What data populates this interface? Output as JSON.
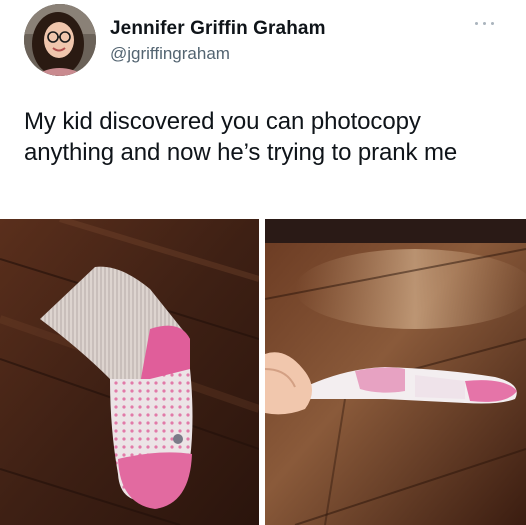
{
  "tweet": {
    "author": {
      "display_name": "Jennifer Griffin Graham",
      "handle": "@jgriffingraham",
      "avatar_icon": "profile-photo"
    },
    "more_icon": "more-options-icon",
    "text": "My kid discovered you can photocopy anything and now he’s trying to prank me",
    "media": [
      {
        "name": "photo-real-sock",
        "description_icon": "sock-on-wood-floor"
      },
      {
        "name": "photo-paper-sock",
        "description_icon": "photocopied-sock-held-in-hand"
      }
    ]
  },
  "colors": {
    "text": "#0f1419",
    "secondary_text": "#536471",
    "sock_pink": "#e0609b",
    "wood_dark": "#3a1e12"
  }
}
